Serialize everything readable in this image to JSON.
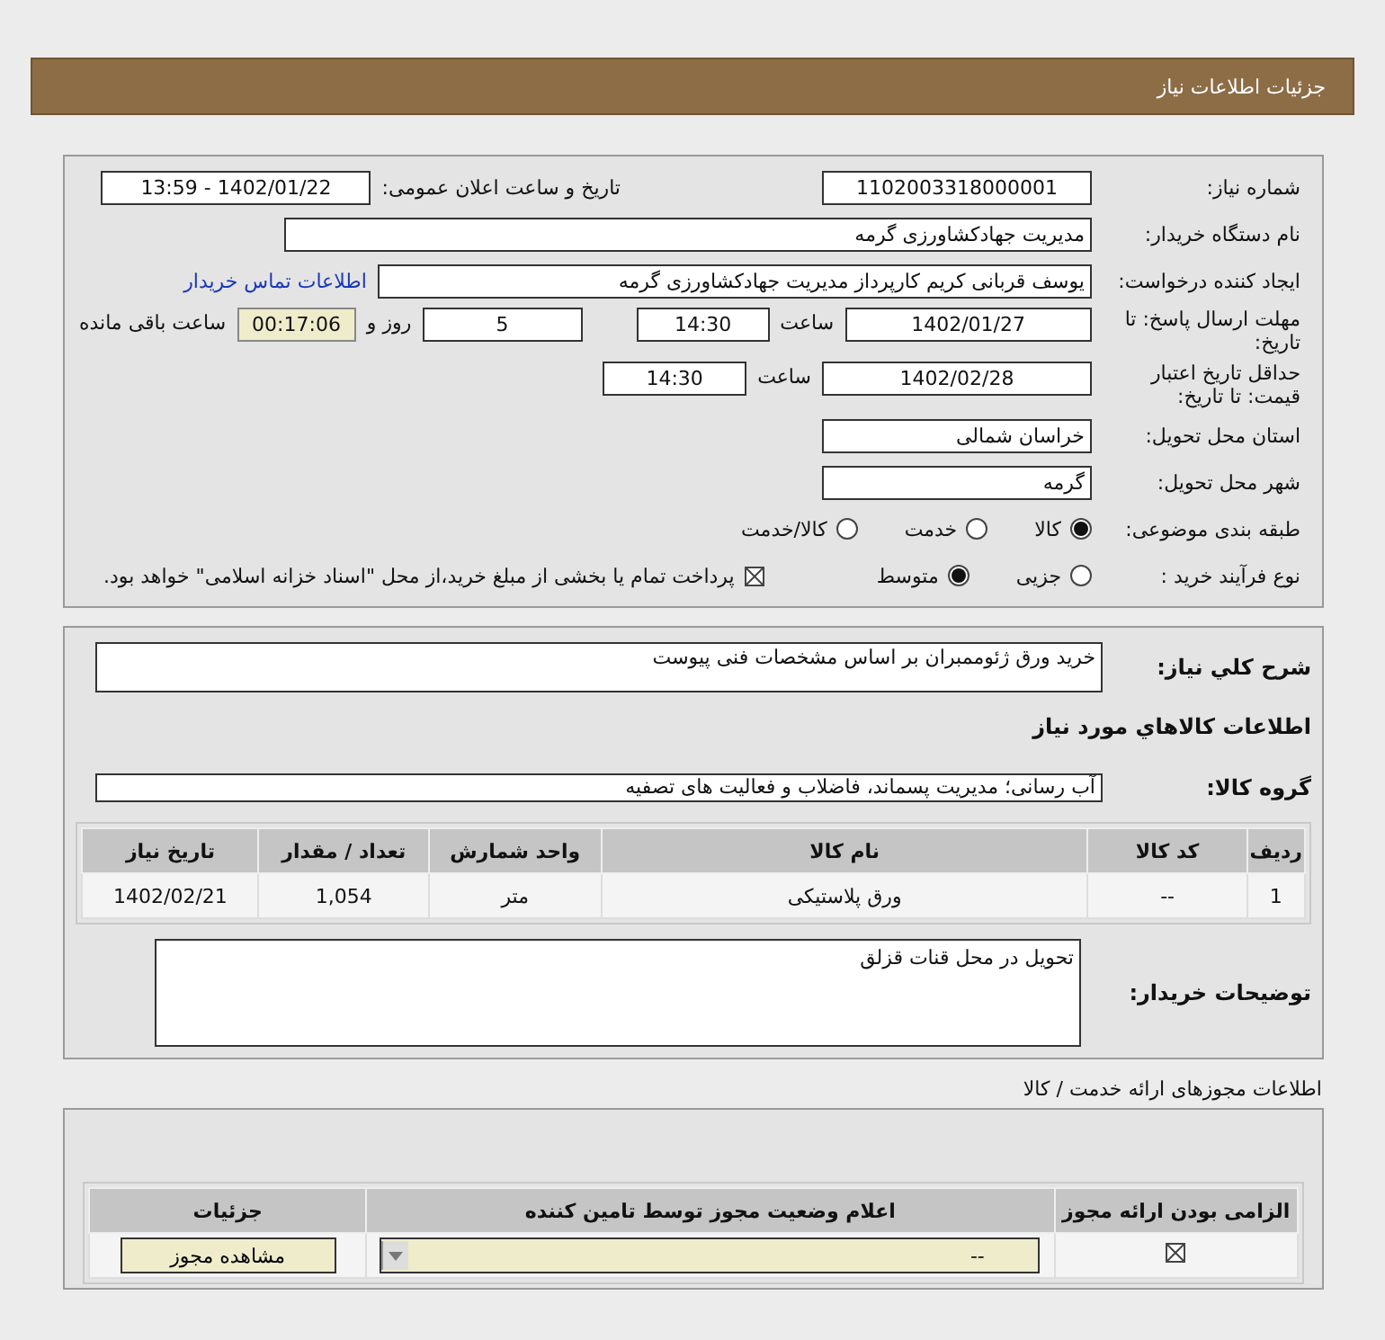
{
  "header": {
    "title": "جزئیات اطلاعات نیاز"
  },
  "details": {
    "need_number": {
      "label": "شماره نیاز:",
      "value": "1102003318000001"
    },
    "announce": {
      "label": "تاریخ و ساعت اعلان عمومی:",
      "value": "1402/01/22 - 13:59"
    },
    "buyer_org": {
      "label": "نام دستگاه خریدار:",
      "value": "مدیریت جهادکشاورزی گرمه"
    },
    "requester": {
      "label": "ایجاد کننده درخواست:",
      "value": "یوسف قربانی کریم کارپرداز مدیریت جهادکشاورزی گرمه",
      "link": "اطلاعات تماس خریدار"
    },
    "deadline": {
      "label": "مهلت ارسال پاسخ: تا تاریخ:",
      "date": "1402/01/27",
      "time_label": "ساعت",
      "time": "14:30",
      "days": "5",
      "days_label": "روز و",
      "remaining": "00:17:06",
      "remaining_label": "ساعت باقی مانده"
    },
    "validity": {
      "label": "حداقل تاریخ اعتبار قیمت: تا تاریخ:",
      "date": "1402/02/28",
      "time_label": "ساعت",
      "time": "14:30"
    },
    "province": {
      "label": "استان محل تحویل:",
      "value": "خراسان شمالی"
    },
    "city": {
      "label": "شهر محل تحویل:",
      "value": "گرمه"
    },
    "category": {
      "label": "طبقه بندی موضوعی:",
      "options": [
        {
          "label": "کالا",
          "selected": true
        },
        {
          "label": "خدمت",
          "selected": false
        },
        {
          "label": "کالا/خدمت",
          "selected": false
        }
      ]
    },
    "process": {
      "label": "نوع فرآیند خرید :",
      "options": [
        {
          "label": "جزیی",
          "selected": false
        },
        {
          "label": "متوسط",
          "selected": true
        }
      ],
      "payment": {
        "checked": true,
        "text": "پرداخت تمام یا بخشی از مبلغ خرید،از محل \"اسناد خزانه اسلامی\" خواهد بود."
      }
    }
  },
  "goods": {
    "description": {
      "label": "شرح کلي نیاز:",
      "value": "خرید ورق ژئوممبران بر اساس مشخصات فنی پیوست"
    },
    "section_title": "اطلاعات کالاهاي مورد نیاز",
    "group": {
      "label": "گروه کالا:",
      "value": "آب رسانی؛ مدیریت پسماند، فاضلاب و فعالیت های تصفیه"
    },
    "table": {
      "columns": [
        "ردیف",
        "کد کالا",
        "نام کالا",
        "واحد شمارش",
        "تعداد / مقدار",
        "تاریخ نیاز"
      ],
      "rows": [
        [
          "1",
          "--",
          "ورق پلاستیکی",
          "متر",
          "1,054",
          "1402/02/21"
        ]
      ]
    },
    "buyer_notes": {
      "label": "توضیحات خریدار:",
      "value": "تحویل در محل قنات قزلق"
    }
  },
  "permits": {
    "title": "اطلاعات مجوزهای ارائه خدمت / کالا",
    "columns": [
      "الزامی بودن ارائه مجوز",
      "اعلام وضعیت مجوز توسط تامین کننده",
      "جزئیات"
    ],
    "rows": [
      {
        "required": true,
        "status": "--",
        "button": "مشاهده مجوز"
      }
    ]
  }
}
